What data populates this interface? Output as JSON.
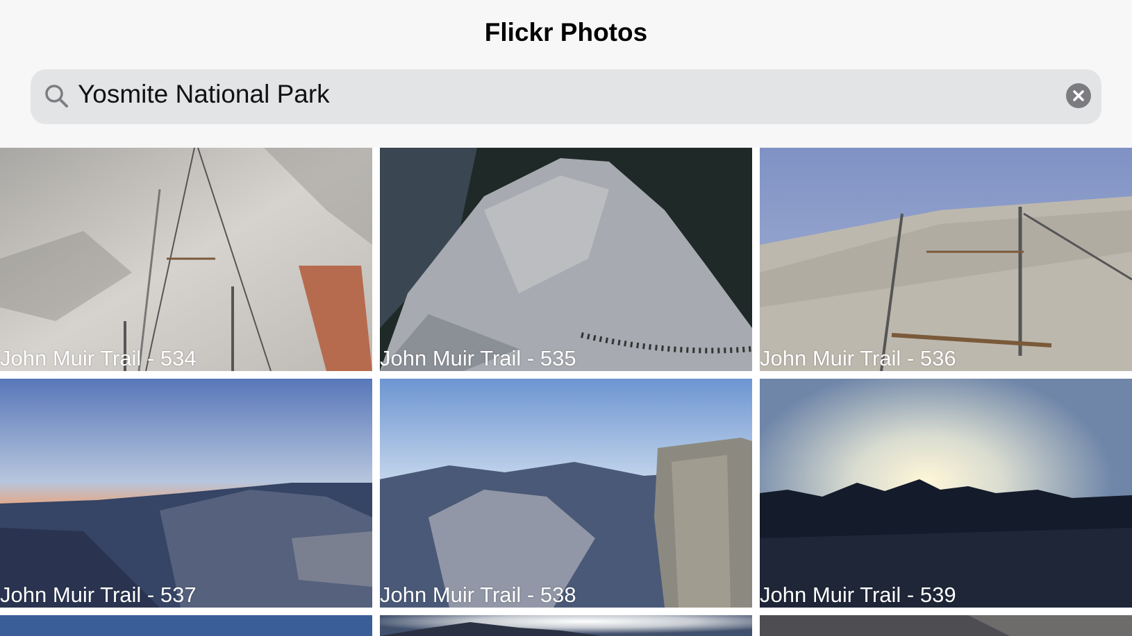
{
  "header": {
    "title": "Flickr Photos"
  },
  "search": {
    "query": "Yosmite National Park"
  },
  "icons": {
    "search": "magnifying-glass-icon",
    "clear": "clear-circle-x-icon"
  },
  "photos": [
    {
      "caption": "John Muir Trail - 534"
    },
    {
      "caption": "John Muir Trail - 535"
    },
    {
      "caption": "John Muir Trail - 536"
    },
    {
      "caption": "John Muir Trail - 537"
    },
    {
      "caption": "John Muir Trail - 538"
    },
    {
      "caption": "John Muir Trail - 539"
    }
  ]
}
